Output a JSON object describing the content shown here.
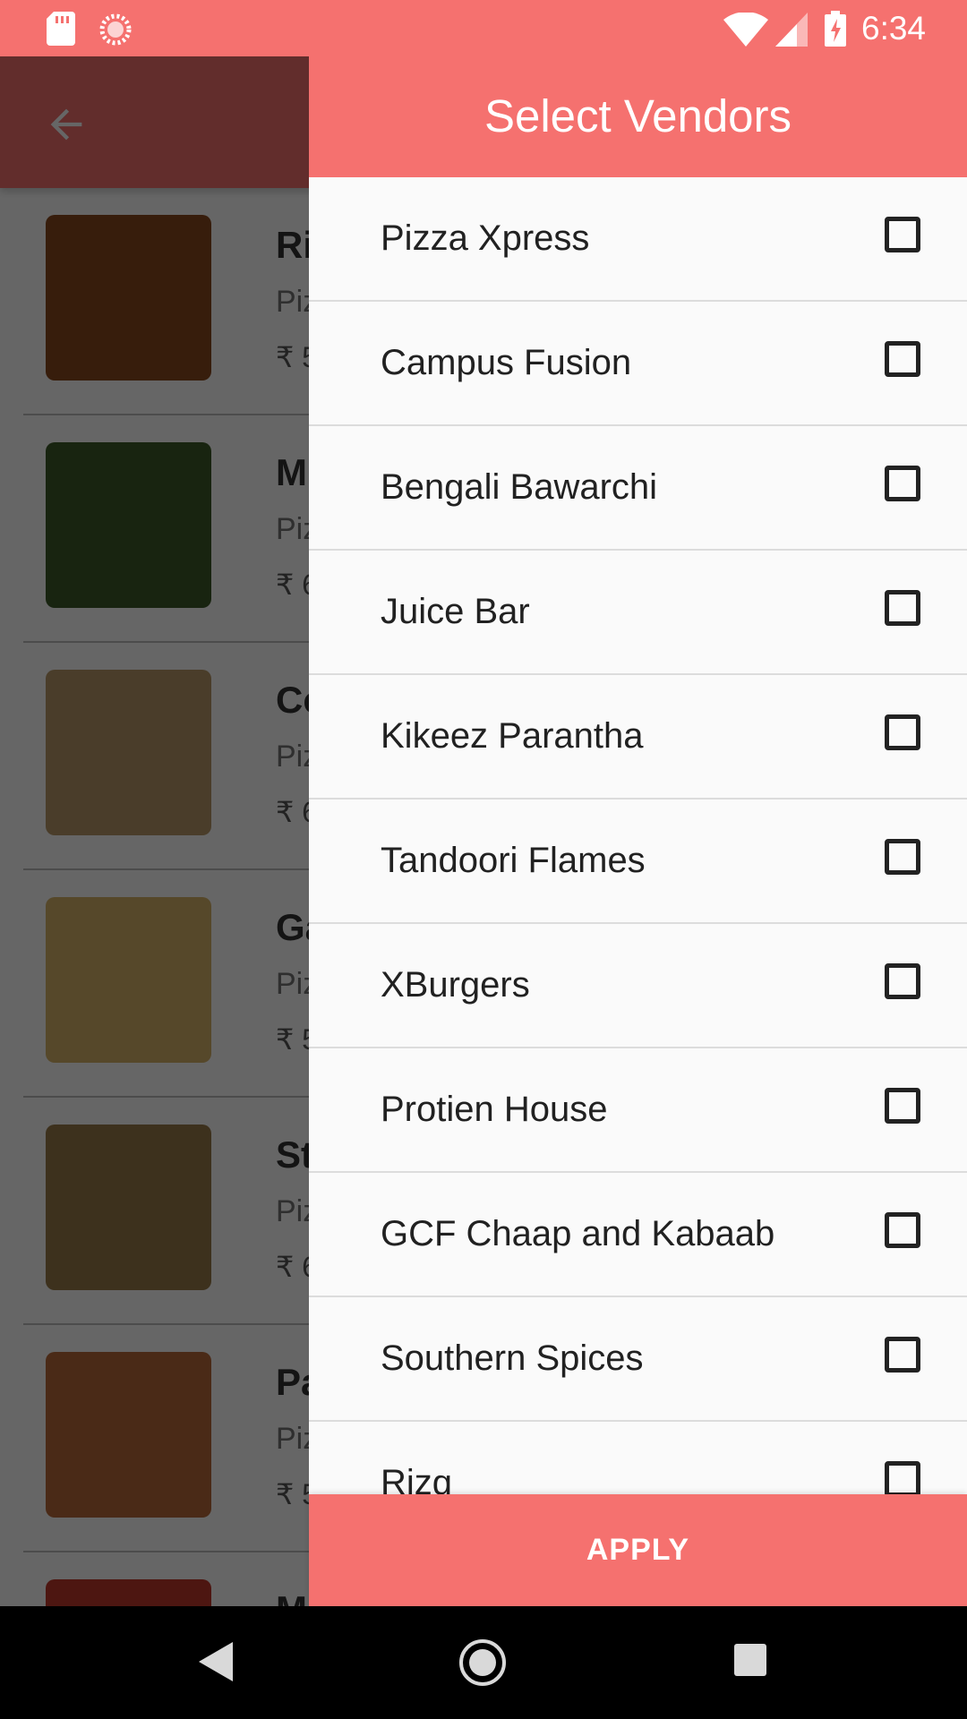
{
  "status_bar": {
    "time": "6:34",
    "icons": [
      "sd-card-icon",
      "loading-icon",
      "wifi-icon",
      "signal-icon",
      "battery-charging-icon"
    ]
  },
  "background": {
    "toolbar_icon": "back-arrow-icon",
    "items": [
      {
        "name": "Ri",
        "vendor": "Piz",
        "price": "₹ 5",
        "thumb_color": "#8a4a1e"
      },
      {
        "name": "M",
        "vendor": "Piz",
        "price": "₹ 6",
        "thumb_color": "#3d5a2a"
      },
      {
        "name": "Co",
        "vendor": "Piz",
        "price": "₹ 6",
        "thumb_color": "#b99a6a"
      },
      {
        "name": "Ga",
        "vendor": "Piz",
        "price": "₹ 5",
        "thumb_color": "#d8b56a"
      },
      {
        "name": "St",
        "vendor": "Piz",
        "price": "₹ 6",
        "thumb_color": "#9a7a4a"
      },
      {
        "name": "Pa",
        "vendor": "Piz",
        "price": "₹ 5",
        "thumb_color": "#b86a3a"
      },
      {
        "name": "M",
        "vendor": "",
        "price": "",
        "thumb_color": "#c0392b"
      }
    ]
  },
  "drawer": {
    "title": "Select Vendors",
    "vendors": [
      {
        "label": "Pizza Xpress",
        "checked": false
      },
      {
        "label": "Campus Fusion",
        "checked": false
      },
      {
        "label": "Bengali Bawarchi",
        "checked": false
      },
      {
        "label": "Juice Bar",
        "checked": false
      },
      {
        "label": "Kikeez Parantha",
        "checked": false
      },
      {
        "label": "Tandoori Flames",
        "checked": false
      },
      {
        "label": "XBurgers",
        "checked": false
      },
      {
        "label": "Protien House",
        "checked": false
      },
      {
        "label": "GCF Chaap and Kabaab",
        "checked": false
      },
      {
        "label": "Southern Spices",
        "checked": false
      },
      {
        "label": "Rizq",
        "checked": false
      }
    ],
    "apply_label": "APPLY"
  },
  "nav_bar": {
    "icons": [
      "back-triangle-icon",
      "home-circle-icon",
      "recents-square-icon"
    ]
  },
  "colors": {
    "accent": "#f5716f",
    "text": "#212121"
  }
}
